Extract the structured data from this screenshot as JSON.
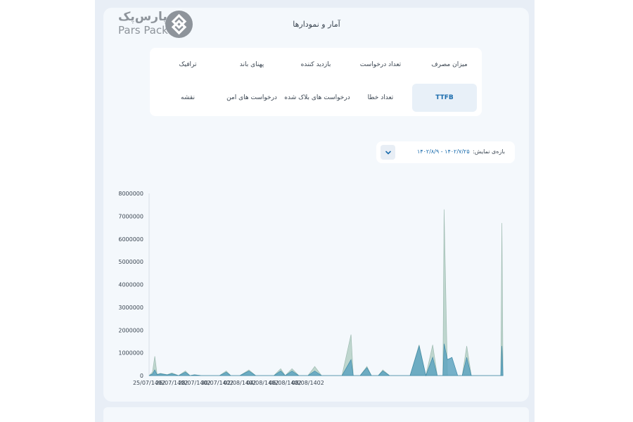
{
  "header": {
    "logo_fa": "پارس‌پک",
    "logo_en": "Pars Pack",
    "title": "آمار و نمودارها"
  },
  "tabs": [
    {
      "label": "میزان مصرف",
      "active": false
    },
    {
      "label": "تعداد درخواست",
      "active": false
    },
    {
      "label": "بازدید کننده",
      "active": false
    },
    {
      "label": "پهنای باند",
      "active": false
    },
    {
      "label": "ترافیک",
      "active": false
    },
    {
      "label": "TTFB",
      "active": true
    },
    {
      "label": "تعداد خطا",
      "active": false
    },
    {
      "label": "درخواست های بلاک شده",
      "active": false
    },
    {
      "label": "درخواست های امن",
      "active": false
    },
    {
      "label": "نقشه",
      "active": false
    }
  ],
  "range": {
    "label": "بازه‌ی نمایش:",
    "value": "۱۴۰۲/۷/۲۵ - ۱۴۰۲/۸/۹",
    "icon": "chevron-down-icon"
  },
  "colors": {
    "accent": "#1b6cad",
    "series_fill": "#5fa4c0",
    "series_back": "#b8d1c9"
  },
  "chart_data": {
    "type": "area",
    "title": "",
    "xlabel": "",
    "ylabel": "",
    "ylim": [
      0,
      8000000
    ],
    "yticks": [
      "0",
      "1000000",
      "2000000",
      "3000000",
      "4000000",
      "5000000",
      "6000000",
      "7000000",
      "8000000"
    ],
    "xtick_labels": [
      "25/07/1402",
      "26/07/1402",
      "28/07/1402",
      "30/07/1402",
      "02/08/1402",
      "04/08/1402",
      "06/08/1402",
      "08/08/1402"
    ],
    "x_domain": [
      0,
      15.5
    ],
    "xtick_positions": [
      0,
      1,
      2,
      3,
      4,
      5,
      6,
      7
    ],
    "series": [
      {
        "points": [
          [
            0,
            0
          ],
          [
            0.15,
            150000
          ],
          [
            0.25,
            850000
          ],
          [
            0.35,
            60000
          ],
          [
            0.5,
            100000
          ],
          [
            0.8,
            40000
          ],
          [
            1.0,
            120000
          ],
          [
            1.3,
            0
          ],
          [
            1.6,
            200000
          ],
          [
            1.8,
            0
          ],
          [
            2.0,
            40000
          ],
          [
            2.3,
            0
          ],
          [
            3.1,
            0
          ],
          [
            3.4,
            200000
          ],
          [
            3.6,
            0
          ],
          [
            4.0,
            0
          ],
          [
            4.4,
            250000
          ],
          [
            4.7,
            0
          ],
          [
            5.5,
            0
          ],
          [
            5.8,
            300000
          ],
          [
            6.0,
            0
          ],
          [
            6.3,
            300000
          ],
          [
            6.6,
            0
          ],
          [
            7.0,
            0
          ],
          [
            7.3,
            400000
          ],
          [
            7.6,
            0
          ],
          [
            8.5,
            0
          ],
          [
            8.9,
            1800000
          ],
          [
            9.0,
            0
          ],
          [
            9.3,
            0
          ],
          [
            9.6,
            400000
          ],
          [
            9.8,
            0
          ],
          [
            10.1,
            0
          ],
          [
            10.3,
            250000
          ],
          [
            10.6,
            0
          ],
          [
            11.5,
            0
          ],
          [
            11.9,
            1350000
          ],
          [
            12.2,
            0
          ],
          [
            12.5,
            1350000
          ],
          [
            12.7,
            0
          ],
          [
            12.95,
            0
          ],
          [
            13.0,
            7300000
          ],
          [
            13.15,
            0
          ],
          [
            13.8,
            0
          ],
          [
            14.0,
            1300000
          ],
          [
            14.2,
            0
          ],
          [
            15.5,
            0
          ],
          [
            15.55,
            6700000
          ],
          [
            15.6,
            0
          ]
        ]
      },
      {
        "points": [
          [
            0,
            0
          ],
          [
            0.15,
            70000
          ],
          [
            0.25,
            250000
          ],
          [
            0.35,
            40000
          ],
          [
            0.5,
            80000
          ],
          [
            0.8,
            30000
          ],
          [
            1.0,
            80000
          ],
          [
            1.3,
            0
          ],
          [
            1.6,
            150000
          ],
          [
            1.8,
            0
          ],
          [
            2.0,
            30000
          ],
          [
            2.3,
            0
          ],
          [
            3.1,
            0
          ],
          [
            3.4,
            150000
          ],
          [
            3.6,
            0
          ],
          [
            4.0,
            0
          ],
          [
            4.4,
            200000
          ],
          [
            4.7,
            0
          ],
          [
            5.5,
            0
          ],
          [
            5.8,
            200000
          ],
          [
            6.0,
            0
          ],
          [
            6.3,
            200000
          ],
          [
            6.6,
            0
          ],
          [
            7.0,
            0
          ],
          [
            7.3,
            200000
          ],
          [
            7.6,
            0
          ],
          [
            8.5,
            0
          ],
          [
            8.9,
            700000
          ],
          [
            9.0,
            0
          ],
          [
            9.3,
            0
          ],
          [
            9.6,
            350000
          ],
          [
            9.8,
            0
          ],
          [
            10.1,
            0
          ],
          [
            10.3,
            200000
          ],
          [
            10.6,
            0
          ],
          [
            11.5,
            0
          ],
          [
            11.9,
            1300000
          ],
          [
            12.2,
            0
          ],
          [
            12.5,
            800000
          ],
          [
            12.7,
            0
          ],
          [
            12.95,
            0
          ],
          [
            13.0,
            1400000
          ],
          [
            13.15,
            700000
          ],
          [
            13.35,
            800000
          ],
          [
            13.6,
            0
          ],
          [
            13.8,
            0
          ],
          [
            14.0,
            800000
          ],
          [
            14.2,
            0
          ],
          [
            15.5,
            0
          ],
          [
            15.55,
            1300000
          ],
          [
            15.6,
            0
          ]
        ]
      }
    ]
  }
}
